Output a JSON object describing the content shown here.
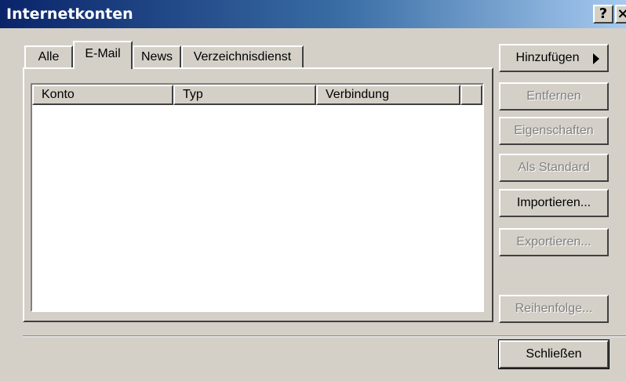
{
  "window": {
    "title": "Internetkonten",
    "help_label": "?",
    "close_label": "×"
  },
  "tabs": [
    {
      "label": "Alle",
      "active": false
    },
    {
      "label": "E-Mail",
      "active": true
    },
    {
      "label": "News",
      "active": false
    },
    {
      "label": "Verzeichnisdienst",
      "active": false
    }
  ],
  "list": {
    "columns": [
      "Konto",
      "Typ",
      "Verbindung"
    ],
    "rows": []
  },
  "buttons": {
    "add": "Hinzufügen",
    "remove": "Entfernen",
    "properties": "Eigenschaften",
    "set_default": "Als Standard",
    "import": "Importieren...",
    "export": "Exportieren...",
    "order": "Reihenfolge...",
    "close": "Schließen"
  },
  "colors": {
    "face": "#d4d0c8",
    "title_start": "#0a246a",
    "title_end": "#a6caf0",
    "disabled_text": "#808080"
  }
}
